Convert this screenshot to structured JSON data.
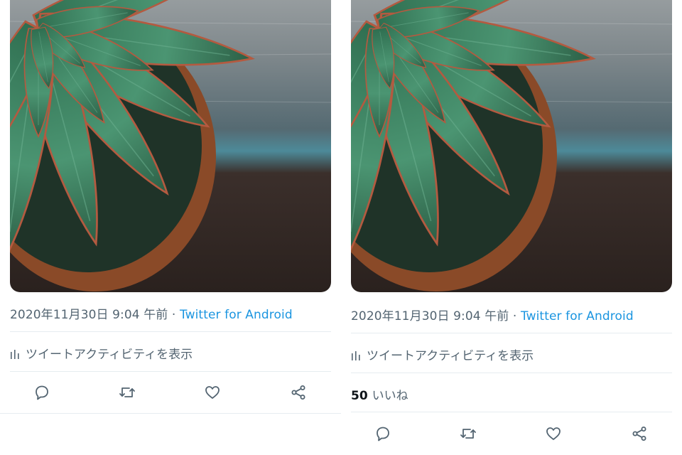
{
  "tweets": [
    {
      "timestamp": "2020年11月30日 9:04 午前",
      "separator": " · ",
      "source": "Twitter for Android",
      "activity_label": "ツイートアクティビティを表示",
      "actions": {
        "reply_icon": "reply-icon",
        "retweet_icon": "retweet-icon",
        "like_icon": "heart-icon",
        "share_icon": "share-icon"
      }
    },
    {
      "timestamp": "2020年11月30日 9:04 午前",
      "separator": " · ",
      "source": "Twitter for Android",
      "activity_label": "ツイートアクティビティを表示",
      "likes_count": "50",
      "likes_label": "いいね",
      "actions": {
        "reply_icon": "reply-icon",
        "retweet_icon": "retweet-icon",
        "like_icon": "heart-icon",
        "share_icon": "share-icon"
      }
    }
  ],
  "colors": {
    "meta_text": "#536471",
    "source_link": "#1b95e0",
    "divider": "#e6ecf0",
    "leaf_green": "#3f8163",
    "pot": "#8a4a28"
  }
}
